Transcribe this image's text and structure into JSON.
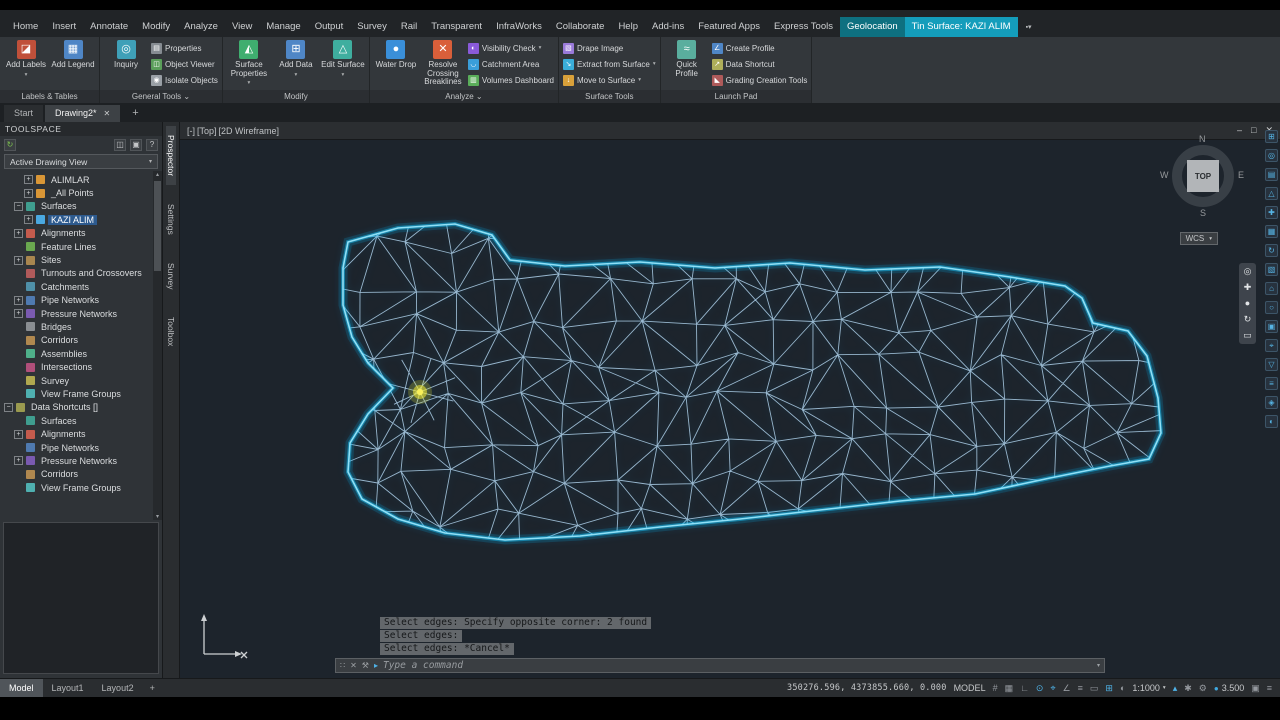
{
  "menu": {
    "tabs": [
      {
        "label": "Home"
      },
      {
        "label": "Insert"
      },
      {
        "label": "Annotate"
      },
      {
        "label": "Modify"
      },
      {
        "label": "Analyze"
      },
      {
        "label": "View"
      },
      {
        "label": "Manage"
      },
      {
        "label": "Output"
      },
      {
        "label": "Survey"
      },
      {
        "label": "Rail"
      },
      {
        "label": "Transparent"
      },
      {
        "label": "InfraWorks"
      },
      {
        "label": "Collaborate"
      },
      {
        "label": "Help"
      },
      {
        "label": "Add-ins"
      },
      {
        "label": "Featured Apps"
      },
      {
        "label": "Express Tools"
      },
      {
        "label": "Geolocation",
        "style": "teal"
      },
      {
        "label": "Tin Surface: KAZI ALIM",
        "style": "cyan"
      }
    ]
  },
  "ribbon": {
    "panels": [
      {
        "title": "Labels & Tables",
        "arrow": false,
        "groups": [
          {
            "kind": "big",
            "items": [
              {
                "label": "Add Labels",
                "icon": "add-labels",
                "arrow": true
              },
              {
                "label": "Add Legend",
                "icon": "add-legend",
                "arrow": false
              }
            ]
          }
        ]
      },
      {
        "title": "General Tools",
        "arrow": true,
        "groups": [
          {
            "kind": "big",
            "items": [
              {
                "label": "Inquiry",
                "icon": "inquiry",
                "arrow": false
              }
            ]
          },
          {
            "kind": "rows",
            "items": [
              {
                "label": "Properties",
                "icon": "properties",
                "arrow": false
              },
              {
                "label": "Object Viewer",
                "icon": "object-viewer",
                "arrow": false
              },
              {
                "label": "Isolate Objects",
                "icon": "isolate-objects",
                "arrow": false
              }
            ]
          }
        ]
      },
      {
        "title": "Modify",
        "arrow": false,
        "groups": [
          {
            "kind": "big",
            "items": [
              {
                "label": "Surface Properties",
                "icon": "surface-properties",
                "arrow": true
              },
              {
                "label": "Add Data",
                "icon": "add-data",
                "arrow": true
              },
              {
                "label": "Edit Surface",
                "icon": "edit-surface",
                "arrow": true
              }
            ]
          }
        ]
      },
      {
        "title": "Analyze",
        "arrow": true,
        "groups": [
          {
            "kind": "big",
            "items": [
              {
                "label": "Water Drop",
                "icon": "water-drop",
                "arrow": false
              },
              {
                "label": "Resolve Crossing Breaklines",
                "icon": "resolve-crossing-breaklines",
                "arrow": false
              }
            ]
          },
          {
            "kind": "rows",
            "items": [
              {
                "label": "Visibility Check",
                "icon": "visibility-check",
                "arrow": true
              },
              {
                "label": "Catchment Area",
                "icon": "catchment-area",
                "arrow": false
              },
              {
                "label": "Volumes Dashboard",
                "icon": "volumes-dashboard",
                "arrow": false
              }
            ]
          }
        ]
      },
      {
        "title": "Surface Tools",
        "arrow": false,
        "groups": [
          {
            "kind": "rows",
            "items": [
              {
                "label": "Drape Image",
                "icon": "drape-image",
                "arrow": false
              },
              {
                "label": "Extract from Surface",
                "icon": "extract-from-surface",
                "arrow": true
              },
              {
                "label": "Move to Surface",
                "icon": "move-to-surface",
                "arrow": true
              }
            ]
          }
        ]
      },
      {
        "title": "Launch Pad",
        "arrow": false,
        "groups": [
          {
            "kind": "big",
            "items": [
              {
                "label": "Quick Profile",
                "icon": "quick-profile",
                "arrow": false
              }
            ]
          },
          {
            "kind": "rows",
            "items": [
              {
                "label": "Create Profile",
                "icon": "create-profile",
                "arrow": false
              },
              {
                "label": "Data Shortcut",
                "icon": "data-shortcut",
                "arrow": false
              },
              {
                "label": "Grading Creation Tools",
                "icon": "grading-creation-tools",
                "arrow": false
              }
            ]
          }
        ]
      }
    ]
  },
  "doc_tabs": [
    {
      "label": "Start",
      "active": false,
      "closable": false
    },
    {
      "label": "Drawing2*",
      "active": true,
      "closable": true
    }
  ],
  "toolspace": {
    "title": "TOOLSPACE",
    "view_dropdown": "Active Drawing View",
    "side_tabs": [
      "Prospector",
      "Settings",
      "Survey",
      "Toolbox"
    ],
    "tree": [
      {
        "label": "ALIMLAR",
        "depth": 2,
        "expand": "+",
        "icon": "point-group"
      },
      {
        "label": "_All Points",
        "depth": 2,
        "expand": "+",
        "icon": "point-group"
      },
      {
        "label": "Surfaces",
        "depth": 1,
        "expand": "-",
        "icon": "surfaces-folder"
      },
      {
        "label": "KAZI ALIM",
        "depth": 2,
        "expand": "+",
        "icon": "surface-item",
        "selected": true
      },
      {
        "label": "Alignments",
        "depth": 1,
        "expand": "+",
        "icon": "alignments"
      },
      {
        "label": "Feature Lines",
        "depth": 1,
        "expand": "",
        "icon": "feature-lines"
      },
      {
        "label": "Sites",
        "depth": 1,
        "expand": "+",
        "icon": "sites"
      },
      {
        "label": "Turnouts and Crossovers",
        "depth": 1,
        "expand": "",
        "icon": "turnouts"
      },
      {
        "label": "Catchments",
        "depth": 1,
        "expand": "",
        "icon": "catchments"
      },
      {
        "label": "Pipe Networks",
        "depth": 1,
        "expand": "+",
        "icon": "pipe-networks"
      },
      {
        "label": "Pressure Networks",
        "depth": 1,
        "expand": "+",
        "icon": "pressure-networks"
      },
      {
        "label": "Bridges",
        "depth": 1,
        "expand": "",
        "icon": "bridges"
      },
      {
        "label": "Corridors",
        "depth": 1,
        "expand": "",
        "icon": "corridors"
      },
      {
        "label": "Assemblies",
        "depth": 1,
        "expand": "",
        "icon": "assemblies"
      },
      {
        "label": "Intersections",
        "depth": 1,
        "expand": "",
        "icon": "intersections"
      },
      {
        "label": "Survey",
        "depth": 1,
        "expand": "",
        "icon": "survey"
      },
      {
        "label": "View Frame Groups",
        "depth": 1,
        "expand": "",
        "icon": "view-frame-groups"
      },
      {
        "label": "Data Shortcuts []",
        "depth": 0,
        "expand": "-",
        "icon": "data-shortcuts"
      },
      {
        "label": "Surfaces",
        "depth": 1,
        "expand": "",
        "icon": "surfaces-folder"
      },
      {
        "label": "Alignments",
        "depth": 1,
        "expand": "+",
        "icon": "alignments"
      },
      {
        "label": "Pipe Networks",
        "depth": 1,
        "expand": "",
        "icon": "pipe-networks"
      },
      {
        "label": "Pressure Networks",
        "depth": 1,
        "expand": "+",
        "icon": "pressure-networks"
      },
      {
        "label": "Corridors",
        "depth": 1,
        "expand": "",
        "icon": "corridors"
      },
      {
        "label": "View Frame Groups",
        "depth": 1,
        "expand": "",
        "icon": "view-frame-groups"
      }
    ]
  },
  "viewport": {
    "controls": [
      "[-]",
      "[Top]",
      "[2D Wireframe]"
    ],
    "viewcube": {
      "n": "N",
      "s": "S",
      "e": "E",
      "w": "W",
      "top": "TOP"
    },
    "wcs": "WCS"
  },
  "command": {
    "history": [
      "Select edges: Specify opposite corner: 2 found",
      "Select edges:",
      "Select edges: *Cancel*"
    ],
    "prompt": "Type a command"
  },
  "status": {
    "tabs": [
      "Model",
      "Layout1",
      "Layout2"
    ],
    "active_tab": "Model",
    "add_tab": "+",
    "coords": "350276.596, 4373855.660, 0.000",
    "items": [
      {
        "t": "text",
        "v": "MODEL",
        "name": "model-space-toggle"
      },
      {
        "t": "icon",
        "g": "#",
        "name": "grid-icon",
        "active": false
      },
      {
        "t": "icon",
        "g": "▦",
        "name": "snap-icon",
        "active": false
      },
      {
        "t": "icon",
        "g": "∟",
        "name": "ortho-icon",
        "active": false
      },
      {
        "t": "icon",
        "g": "⊙",
        "name": "polar-tracking-icon",
        "active": true
      },
      {
        "t": "icon",
        "g": "⌖",
        "name": "osnap-icon",
        "active": true
      },
      {
        "t": "icon",
        "g": "∠",
        "name": "otrack-icon",
        "active": false
      },
      {
        "t": "icon",
        "g": "≡",
        "name": "lineweight-icon",
        "active": false
      },
      {
        "t": "icon",
        "g": "▭",
        "name": "transparency-icon",
        "active": false
      },
      {
        "t": "icon",
        "g": "⊞",
        "name": "selection-cycling-icon",
        "active": true
      },
      {
        "t": "icon",
        "g": "◐",
        "name": "dynamic-input-icon",
        "active": false
      },
      {
        "t": "scale",
        "v": "1:1000",
        "name": "annotation-scale"
      },
      {
        "t": "icon",
        "g": "▴",
        "name": "annotation-visibility-icon",
        "active": true
      },
      {
        "t": "icon",
        "g": "✱",
        "name": "autoscale-icon",
        "active": false
      },
      {
        "t": "icon",
        "g": "⚙",
        "name": "workspace-gear-icon",
        "active": false
      },
      {
        "t": "dot-text",
        "v": "3.500",
        "name": "elevation-indicator"
      },
      {
        "t": "icon",
        "g": "▣",
        "name": "isolate-objects-status-icon",
        "active": false
      },
      {
        "t": "icon",
        "g": "≡",
        "name": "customize-icon",
        "active": false
      }
    ]
  }
}
